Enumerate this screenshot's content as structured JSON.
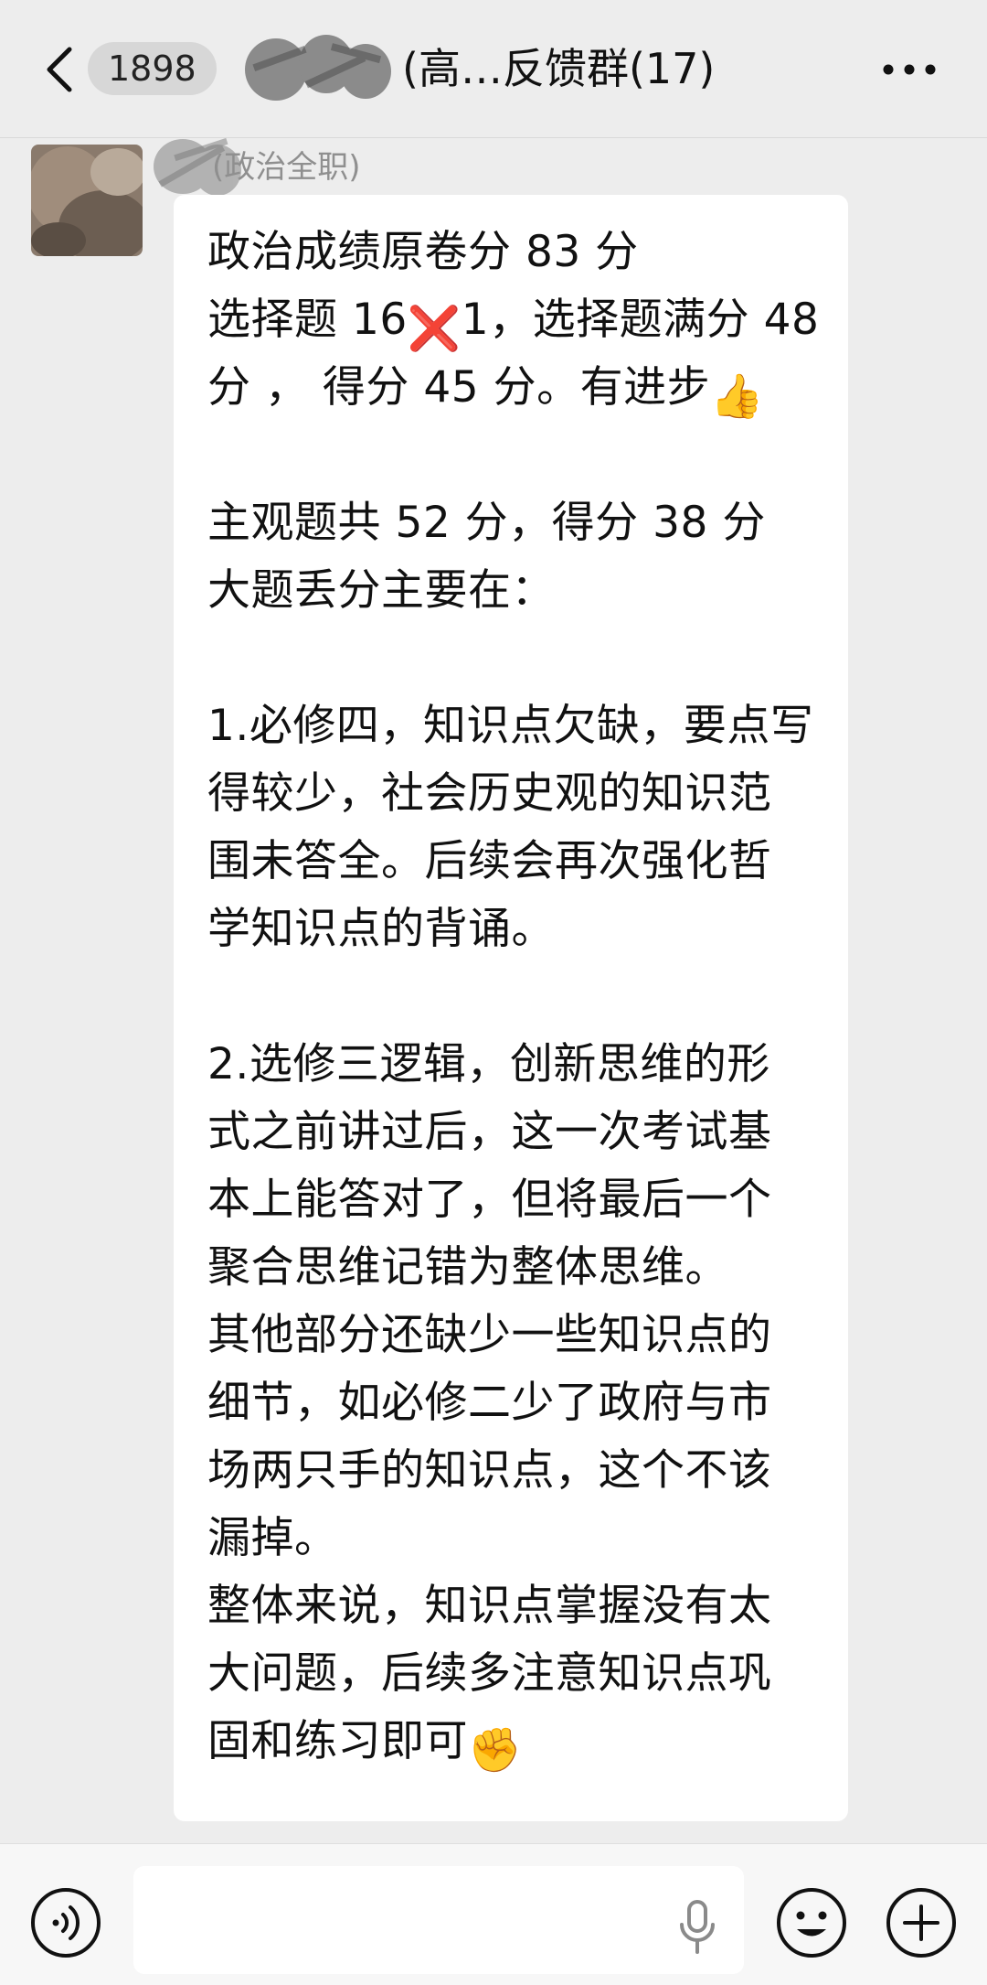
{
  "header": {
    "back_icon": "chevron-left-icon",
    "unread_count": "1898",
    "title": "(高…反馈群(17)",
    "more_icon": "more-dots-icon"
  },
  "message": {
    "sender_name": "(政治全职)",
    "lines": [
      {
        "text": "政治成绩原卷分 83 分"
      },
      {
        "text": "选择题 16",
        "emoji": "❌",
        "text_after": "1，选择题满分 48"
      },
      {
        "text": "分 ， 得分 45 分。有进步",
        "emoji": "👍"
      },
      {
        "text": ""
      },
      {
        "text": "主观题共 52 分，得分 38 分"
      },
      {
        "text": "大题丢分主要在："
      },
      {
        "text": ""
      },
      {
        "text": "1.必修四，知识点欠缺，要点写"
      },
      {
        "text": "得较少，社会历史观的知识范"
      },
      {
        "text": "围未答全。后续会再次强化哲"
      },
      {
        "text": "学知识点的背诵。"
      },
      {
        "text": ""
      },
      {
        "text": "2.选修三逻辑，创新思维的形"
      },
      {
        "text": "式之前讲过后，这一次考试基"
      },
      {
        "text": "本上能答对了，但将最后一个"
      },
      {
        "text": "聚合思维记错为整体思维。"
      },
      {
        "text": "其他部分还缺少一些知识点的"
      },
      {
        "text": "细节，如必修二少了政府与市"
      },
      {
        "text": "场两只手的知识点，这个不该"
      },
      {
        "text": "漏掉。"
      },
      {
        "text": "整体来说，知识点掌握没有太"
      },
      {
        "text": "大问题，后续多注意知识点巩"
      },
      {
        "text": "固和练习即可",
        "emoji": "✊"
      }
    ]
  },
  "input_bar": {
    "voice_icon": "voice-wave-icon",
    "mic_icon": "microphone-icon",
    "emoji_icon": "smiley-face-icon",
    "plus_icon": "plus-circle-icon",
    "placeholder": ""
  }
}
